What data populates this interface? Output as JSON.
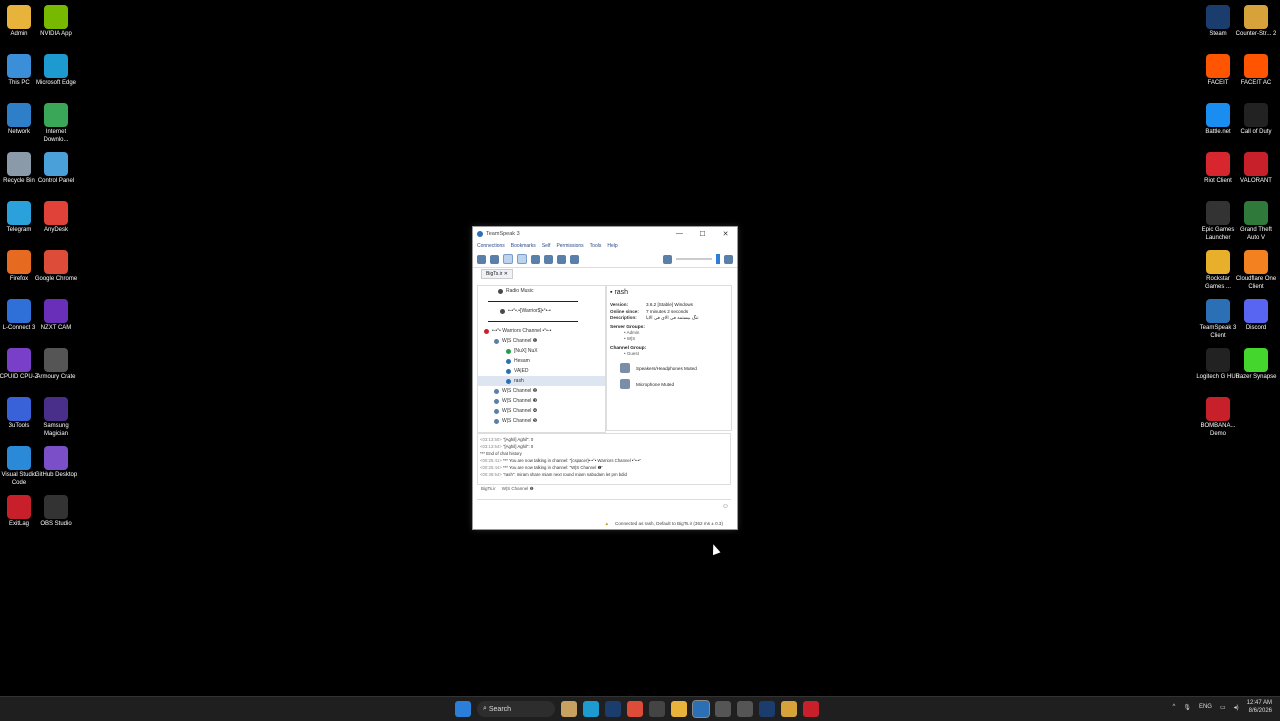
{
  "desktop": {
    "left_icons": [
      {
        "label": "Admin",
        "color": "#e8b33a"
      },
      {
        "label": "NVIDIA App",
        "color": "#76b900"
      },
      {
        "label": "This PC",
        "color": "#3a8fd8"
      },
      {
        "label": "Microsoft Edge",
        "color": "#1d9bd1"
      },
      {
        "label": "Network",
        "color": "#2f7fc8"
      },
      {
        "label": "Internet Downlo...",
        "color": "#3aa657"
      },
      {
        "label": "Recycle Bin",
        "color": "#8a9aa8"
      },
      {
        "label": "Control Panel",
        "color": "#4aa0d8"
      },
      {
        "label": "Telegram",
        "color": "#2aa1da"
      },
      {
        "label": "AnyDesk",
        "color": "#e0423a"
      },
      {
        "label": "Firefox",
        "color": "#e66a20"
      },
      {
        "label": "Google Chrome",
        "color": "#dd4b39"
      },
      {
        "label": "L-Connect 3",
        "color": "#2e6fd8"
      },
      {
        "label": "NZXT CAM",
        "color": "#6a2fb8"
      },
      {
        "label": "CPUID CPU-Z",
        "color": "#7a3fc8"
      },
      {
        "label": "Armoury Crate",
        "color": "#555555"
      },
      {
        "label": "3uTools",
        "color": "#3a62d8"
      },
      {
        "label": "Samsung Magician",
        "color": "#4a2f8a"
      },
      {
        "label": "Visual Studio Code",
        "color": "#2a8ad8"
      },
      {
        "label": "GitHub Desktop",
        "color": "#7a4fc8"
      },
      {
        "label": "ExitLag",
        "color": "#c8202a"
      },
      {
        "label": "OBS Studio",
        "color": "#333333"
      }
    ],
    "right_icons": [
      {
        "label": "Steam",
        "color": "#1b3d6d"
      },
      {
        "label": "Counter-Str... 2",
        "color": "#d8a23a"
      },
      {
        "label": "FACEIT",
        "color": "#ff5500"
      },
      {
        "label": "FACEIT AC",
        "color": "#ff5500"
      },
      {
        "label": "Battle.net",
        "color": "#1a8ef0"
      },
      {
        "label": "Call of Duty",
        "color": "#222222"
      },
      {
        "label": "Riot Client",
        "color": "#d8262f"
      },
      {
        "label": "VALORANT",
        "color": "#c8202a"
      },
      {
        "label": "Epic Games Launcher",
        "color": "#333333"
      },
      {
        "label": "Grand Theft Auto V",
        "color": "#2f7a3a"
      },
      {
        "label": "Rockstar Games ...",
        "color": "#e8b02a"
      },
      {
        "label": "Cloudflare One Client",
        "color": "#f48120"
      },
      {
        "label": "TeamSpeak 3 Client",
        "color": "#2b6fb5"
      },
      {
        "label": "Discord",
        "color": "#5865f2"
      },
      {
        "label": "Logitech G HUB",
        "color": "#222222"
      },
      {
        "label": "Razer Synapse",
        "color": "#44d62c"
      },
      {
        "label": "BOMBANA... Demo",
        "color": "#c8202a"
      }
    ]
  },
  "teamspeak": {
    "title": "TeamSpeak 3",
    "window_controls": [
      "—",
      "☐",
      "✕"
    ],
    "menu": [
      "Connections",
      "Bookmarks",
      "Self",
      "Permissions",
      "Tools",
      "Help"
    ],
    "tab": "BigTs.ir",
    "tree": [
      {
        "label": "Radio Music",
        "indent": 20,
        "color": "#4a4a4a",
        "sel": false
      },
      {
        "label": "",
        "indent": 10,
        "color": "",
        "sel": false
      },
      {
        "label": "•-•°•.•[Warrior$]•°•-•",
        "indent": 22,
        "color": "#4a4a4a",
        "sel": false
      },
      {
        "label": "",
        "indent": 10,
        "color": "",
        "sel": false
      },
      {
        "label": "•-•°• Warriors Channel •°•-•",
        "indent": 6,
        "color": "#c8202a",
        "sel": false
      },
      {
        "label": "W|S Channel ❶",
        "indent": 16,
        "color": "#5a7fa8",
        "sel": false
      },
      {
        "label": "[NuX] NuX",
        "indent": 28,
        "color": "#2a9a4a",
        "sel": false
      },
      {
        "label": "Hesam",
        "indent": 28,
        "color": "#2b6fb5",
        "sel": false
      },
      {
        "label": "VA|ED",
        "indent": 28,
        "color": "#2b6fb5",
        "sel": false
      },
      {
        "label": "rash",
        "indent": 28,
        "color": "#2b6fb5",
        "sel": true
      },
      {
        "label": "W|S Channel ❷",
        "indent": 16,
        "color": "#5a7fa8",
        "sel": false
      },
      {
        "label": "W|S Channel ❸",
        "indent": 16,
        "color": "#5a7fa8",
        "sel": false
      },
      {
        "label": "W|S Channel ❹",
        "indent": 16,
        "color": "#5a7fa8",
        "sel": false
      },
      {
        "label": "W|S Channel ❺",
        "indent": 16,
        "color": "#5a7fa8",
        "sel": false
      }
    ],
    "info": {
      "nickname": "rash",
      "version_label": "Version:",
      "version": "3.6.2 [Stable] Windows",
      "online_label": "Online since:",
      "online": "7 minutes 2 seconds",
      "desc_label": "Description:",
      "desc": "تنگ بیستمه فی الای فی الایا",
      "server_groups_label": "Server Groups:",
      "server_groups": [
        "Admin",
        "W|S"
      ],
      "channel_group_label": "Channel Group:",
      "channel_group": "Guest",
      "muted_speakers": "Speakers/Headphones Muted",
      "muted_mic": "Microphone Muted"
    },
    "chat": [
      {
        "time": "<03:13:50>",
        "text": "\"[Aghil] Aghil\": 0"
      },
      {
        "time": "<03:13:54>",
        "text": "\"[Aghil] Aghil\": 0"
      },
      {
        "time": "",
        "text": "*** End of chat history"
      },
      {
        "time": "<00:25:41>",
        "text": "*** You are now talking in channel: \"[cspacer]•-•°• Warriors Channel •°•-•\""
      },
      {
        "time": "<00:25:44>",
        "text": "*** You are now talking in channel: \"W|S Channel ❶\""
      },
      {
        "time": "<00:36:54>",
        "text": "\"rash\": miram share miam next round miam nabodam let pm bdid"
      }
    ],
    "chat_tabs": [
      "BigTs.ir",
      "W|S Channel ❶"
    ],
    "status": "Connected as rash, Default to BigTs.ir (362 ms ± 0.3)"
  },
  "taskbar": {
    "search_placeholder": "Search",
    "tray_lang": "ENG",
    "time": "12:47 AM",
    "date": "8/6/2026"
  }
}
